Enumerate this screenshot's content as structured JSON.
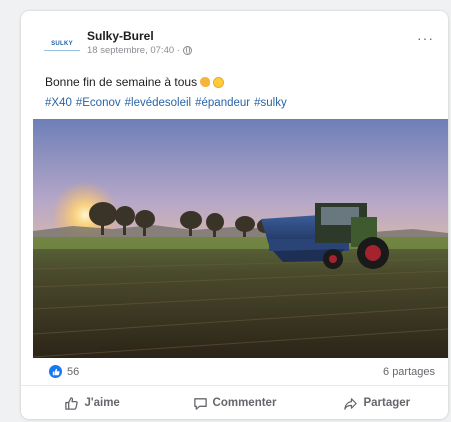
{
  "post": {
    "page_name": "Sulky-Burel",
    "avatar_text": "SULKY",
    "timestamp": "18 septembre, 07:40 ·",
    "more_label": "···",
    "text": "Bonne fin de semaine à tous",
    "hashtags": [
      "#X40",
      "#Econov",
      "#levédesoleil",
      "#épandeur",
      "#sulky"
    ]
  },
  "stats": {
    "reaction_count": "56",
    "shares": "6 partages"
  },
  "actions": {
    "like": "J'aime",
    "comment": "Commenter",
    "share": "Partager"
  },
  "colors": {
    "facebook_blue": "#1877f2",
    "hashtag_blue": "#2a64a8"
  },
  "icons": {
    "privacy": "globe-icon",
    "reaction": "thumbs-up-icon",
    "like": "thumbs-up-outline-icon",
    "comment": "speech-bubble-icon",
    "share": "share-arrow-icon"
  }
}
